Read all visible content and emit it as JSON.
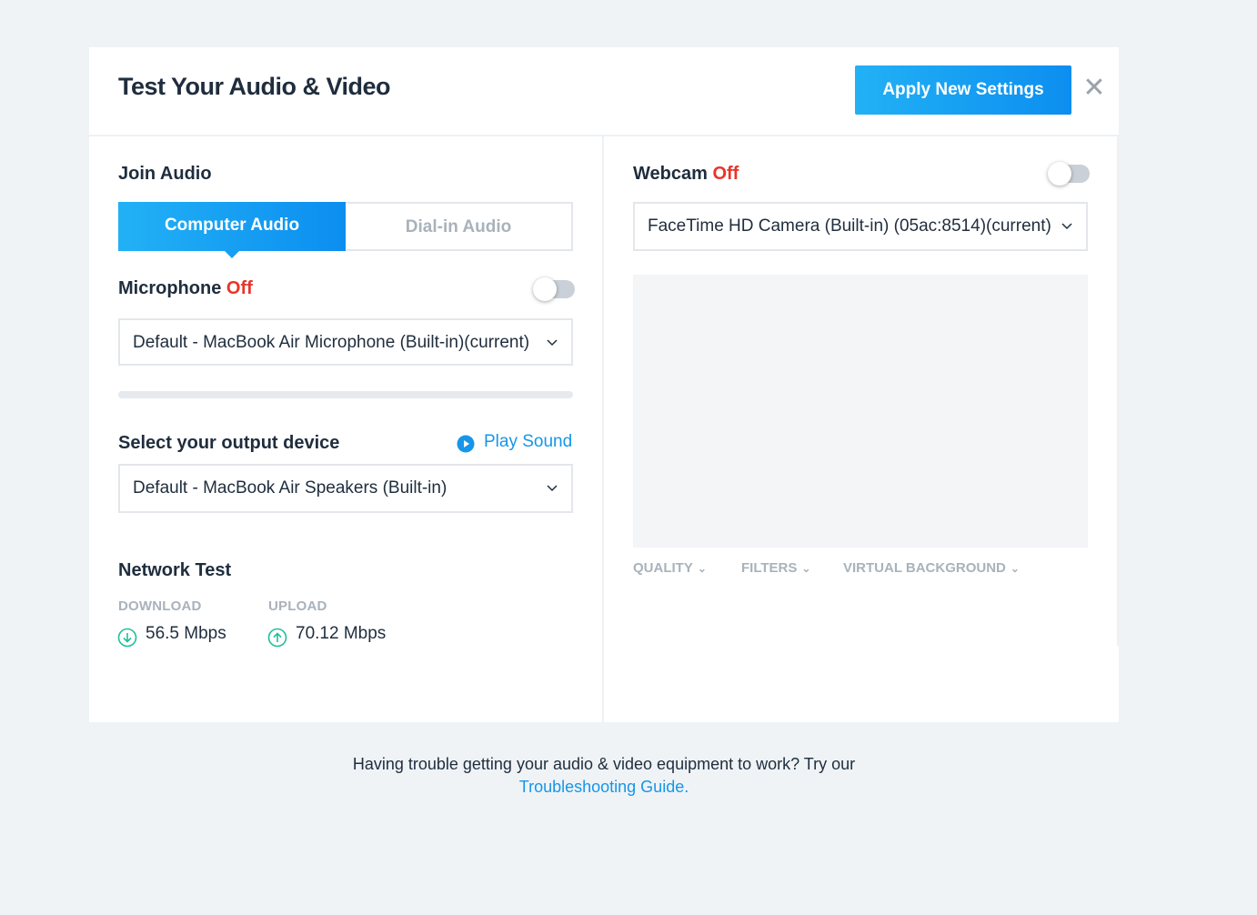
{
  "modal": {
    "title": "Test Your Audio & Video",
    "apply_label": "Apply New Settings",
    "close_glyph": "✕"
  },
  "audio": {
    "heading": "Join Audio",
    "tabs": [
      {
        "label": "Computer Audio",
        "active": true
      },
      {
        "label": "Dial-in Audio",
        "active": false
      }
    ],
    "microphone": {
      "label": "Microphone",
      "state": "Off",
      "toggle_on": false,
      "device": "Default - MacBook Air Microphone (Built-in)(current)",
      "level": 0
    },
    "output": {
      "label": "Select your output device",
      "play_label": "Play Sound",
      "device": "Default - MacBook Air Speakers (Built-in)"
    },
    "network": {
      "heading": "Network Test",
      "download_label": "DOWNLOAD",
      "download_value": "56.5 Mbps",
      "upload_label": "UPLOAD",
      "upload_value": "70.12 Mbps"
    }
  },
  "webcam": {
    "label": "Webcam",
    "state": "Off",
    "toggle_on": false,
    "device": "FaceTime HD Camera (Built-in) (05ac:8514)(current)",
    "tabs": [
      {
        "label": "QUALITY"
      },
      {
        "label": "FILTERS"
      },
      {
        "label": "VIRTUAL BACKGROUND"
      }
    ]
  },
  "footer": {
    "text": "Having trouble getting your audio & video equipment to work? Try our",
    "link": "Troubleshooting Guide."
  },
  "colors": {
    "accent": "#1696e8",
    "off": "#e8352b",
    "background": "#eff3f6"
  }
}
